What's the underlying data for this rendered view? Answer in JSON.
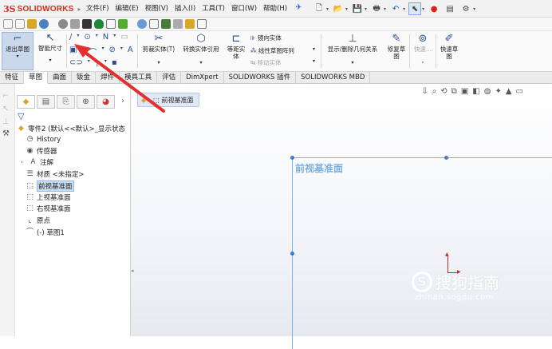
{
  "app": {
    "logo_ds": "3S",
    "logo_text": "SOLIDWORKS"
  },
  "menu": [
    "文件(F)",
    "编辑(E)",
    "视图(V)",
    "插入(I)",
    "工具(T)",
    "窗口(W)",
    "帮助(H)"
  ],
  "toolbar": {
    "exit_sketch": "退出草图",
    "smart_dimension": "智能尺寸",
    "trim_entities": "剪裁实体(T)",
    "convert_entities": "转换实体引用",
    "offset_entities": "等距实体",
    "mirror_entities": "镜向实体",
    "linear_pattern": "线性草图阵列",
    "move_entities": "移动实体",
    "display_relations": "显示/删除几何关系",
    "repair_sketch": "修复草图",
    "quick_snaps": "快速...",
    "rapid_sketch": "快速草图"
  },
  "tabs": [
    "特征",
    "草图",
    "曲面",
    "钣金",
    "焊件",
    "模具工具",
    "评估",
    "DimXpert",
    "SOLIDWORKS 插件",
    "SOLIDWORKS MBD"
  ],
  "active_tab": "草图",
  "feature_tree": {
    "root": "零件2 (默认<<默认>_显示状态",
    "items": [
      {
        "label": "History",
        "icon": "history-icon"
      },
      {
        "label": "传感器",
        "icon": "sensor-icon"
      },
      {
        "label": "注解",
        "icon": "annotation-icon"
      },
      {
        "label": "材质 <未指定>",
        "icon": "material-icon"
      },
      {
        "label": "前视基准面",
        "icon": "plane-icon",
        "selected": true
      },
      {
        "label": "上视基准面",
        "icon": "plane-icon"
      },
      {
        "label": "右视基准面",
        "icon": "plane-icon"
      },
      {
        "label": "原点",
        "icon": "origin-icon"
      },
      {
        "label": "(-) 草图1",
        "icon": "sketch-icon"
      }
    ]
  },
  "viewport": {
    "plane_tag": "前视基准面",
    "plane_label": "前视基准面",
    "watermark": "搜狗指南",
    "watermark_url": "zhinan.sogou.com"
  },
  "colors": {
    "accent": "#1a5fb4",
    "plane_edge": "#7ab0e2",
    "arrow_red": "#e23030",
    "brand_red": "#d52b1e"
  }
}
